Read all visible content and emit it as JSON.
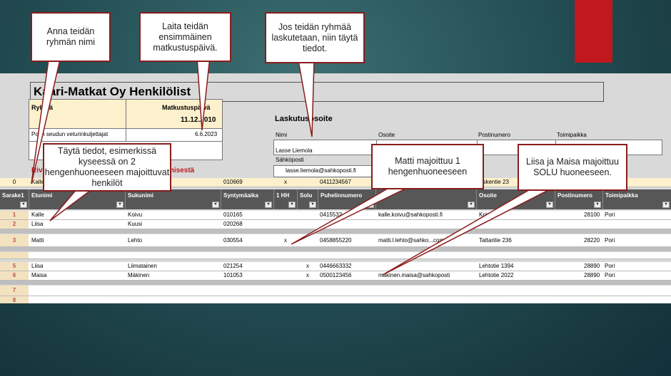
{
  "sheet": {
    "title": "Kaari-Matkat Oy Henkilölist",
    "group_label": "Ryhmä",
    "date_label": "Matkustuspäivä",
    "date_example": "11.12.2010",
    "group_name": "Porin seudun veturinkuljettajat",
    "travel_date": "6.6.2023",
    "billing_title": "Laskutusosoite",
    "billing_cols": [
      "Nimi",
      "Osoite",
      "Postinumero",
      "Toimipaikka"
    ],
    "billing_name": "Lasse Liemola",
    "email_label": "Sähköposti",
    "email_value": "lasse.liemola@sahkoposti.fi",
    "row0": {
      "num": "0",
      "name": "Kalle",
      "birth": "010669",
      "hh": "x",
      "phone": "0411234567",
      "address": "oskentie 23"
    },
    "red_left": "Riv",
    "red_right": "misestä",
    "sarake": "Sarake1",
    "columns": [
      "Etunimi",
      "Sukunimi",
      "Syntymäaika",
      "1 HH",
      "Solu",
      "Puhelinnumero",
      "",
      "Osoite",
      "Postinumero",
      "Toimipaikka"
    ],
    "rows": [
      {
        "num": "1",
        "first": "Kalle",
        "last": "Koivu",
        "birth": "010165",
        "hh": "",
        "solu": "",
        "phone": "0415532",
        "email": "kalle.koivu@sahkoposti.fi",
        "addr": "Koi",
        "zip": "28100",
        "city": "Pori"
      },
      {
        "num": "2",
        "first": "Liisa",
        "last": "Kuusi",
        "birth": "020268",
        "hh": "",
        "solu": "",
        "phone": "",
        "email": "",
        "addr": "",
        "zip": "",
        "city": ""
      },
      {
        "num": "3",
        "first": "Matti",
        "last": "Lehto",
        "birth": "030554",
        "hh": "x",
        "solu": "",
        "phone": "0458855220",
        "email": "matti.l.lehto@sahko...com",
        "addr": "Tattaritie 236",
        "zip": "28220",
        "city": "Pori"
      },
      {
        "num": "5",
        "first": "Liisa",
        "last": "Liimatainen",
        "birth": "021254",
        "hh": "",
        "solu": "x",
        "phone": "0446663332",
        "email": "",
        "addr": "Lehtotie 1394",
        "zip": "28890",
        "city": "Pori"
      },
      {
        "num": "6",
        "first": "Maisa",
        "last": "Mäkinen",
        "birth": "101053",
        "hh": "",
        "solu": "x",
        "phone": "0500123456",
        "email": "makinen.maisa@sahkoposti",
        "addr": "Lehtotie 2022",
        "zip": "28890",
        "city": "Pori"
      },
      {
        "num": "7",
        "first": "",
        "last": "",
        "birth": "",
        "hh": "",
        "solu": "",
        "phone": "",
        "email": "",
        "addr": "",
        "zip": "",
        "city": ""
      },
      {
        "num": "8",
        "first": "",
        "last": "",
        "birth": "",
        "hh": "",
        "solu": "",
        "phone": "",
        "email": "",
        "addr": "",
        "zip": "",
        "city": ""
      }
    ]
  },
  "callouts": {
    "group_name": "Anna teidän ryhmän nimi",
    "first_date": "Laita teidän ensimmäinen matkustuspäivä.",
    "billing": "Jos teidän ryhmää laskutetaan, niin täytä tiedot.",
    "fill_info": "Täytä tiedot, esimerkissä kyseessä on 2 hengenhuoneeseen majoittuvat henkilöt",
    "matti": "Matti majoittuu 1 hengenhuoneeseen",
    "solu": "Liisa ja Maisa majoittuu SOLU huoneeseen."
  },
  "colors": {
    "accent_red": "#c0181c",
    "callout_border": "#8a1c1c",
    "header_gray": "#575757",
    "row_number_bg": "#f3e2bf"
  }
}
